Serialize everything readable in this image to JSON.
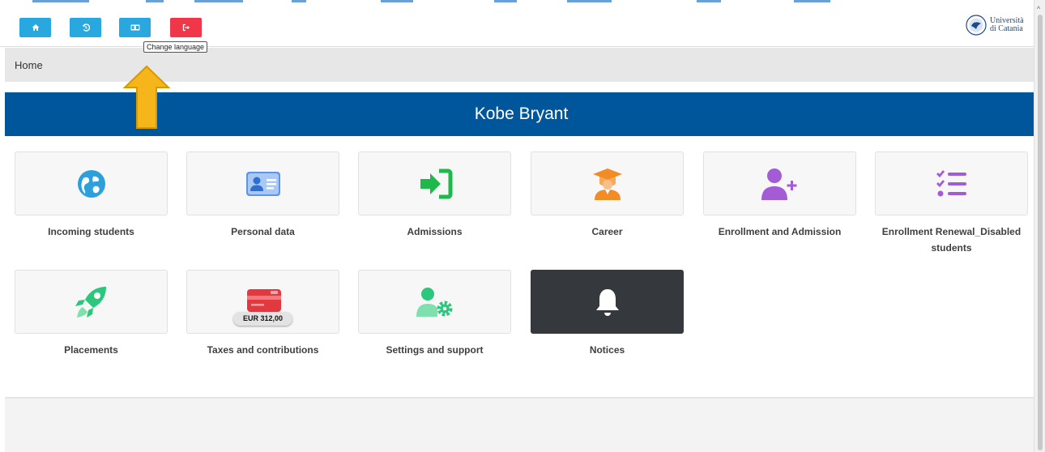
{
  "toolbar": {
    "buttons": [
      {
        "name": "home-button",
        "icon": "home-icon"
      },
      {
        "name": "history-button",
        "icon": "history-icon"
      },
      {
        "name": "change-language-button",
        "icon": "language-card-icon"
      },
      {
        "name": "logout-button",
        "icon": "logout-icon"
      }
    ],
    "tooltip": "Change language",
    "logo": {
      "line1": "Università",
      "line2": "di Catania"
    }
  },
  "breadcrumb": {
    "current": "Home"
  },
  "banner": {
    "user_name": "Kobe Bryant"
  },
  "tiles": [
    {
      "label": "Incoming students",
      "icon": "globe-icon",
      "color": "#2d9fdb"
    },
    {
      "label": "Personal data",
      "icon": "id-card-icon",
      "color": "#5b95e8"
    },
    {
      "label": "Admissions",
      "icon": "sign-in-icon",
      "color": "#1fb84a"
    },
    {
      "label": "Career",
      "icon": "graduate-icon",
      "color": "#f28c24"
    },
    {
      "label": "Enrollment and Admission",
      "icon": "user-plus-icon",
      "color": "#a35cd6"
    },
    {
      "label": "Enrollment Renewal_Disabled students",
      "icon": "checklist-icon",
      "color": "#a35cd6"
    },
    {
      "label": "Placements",
      "icon": "rocket-icon",
      "color": "#2bc77c"
    },
    {
      "label": "Taxes and contributions",
      "icon": "credit-card-icon",
      "color": "#e03a40",
      "badge": "EUR 312,00"
    },
    {
      "label": "Settings and support",
      "icon": "user-settings-icon",
      "color": "#2bc77c"
    },
    {
      "label": "Notices",
      "icon": "bell-icon",
      "color": "#ffffff"
    }
  ],
  "colors": {
    "banner": "#00569a",
    "toolbar_blue": "#29a8e0",
    "toolbar_red": "#f0374a",
    "arrow": "#f7b51c"
  }
}
